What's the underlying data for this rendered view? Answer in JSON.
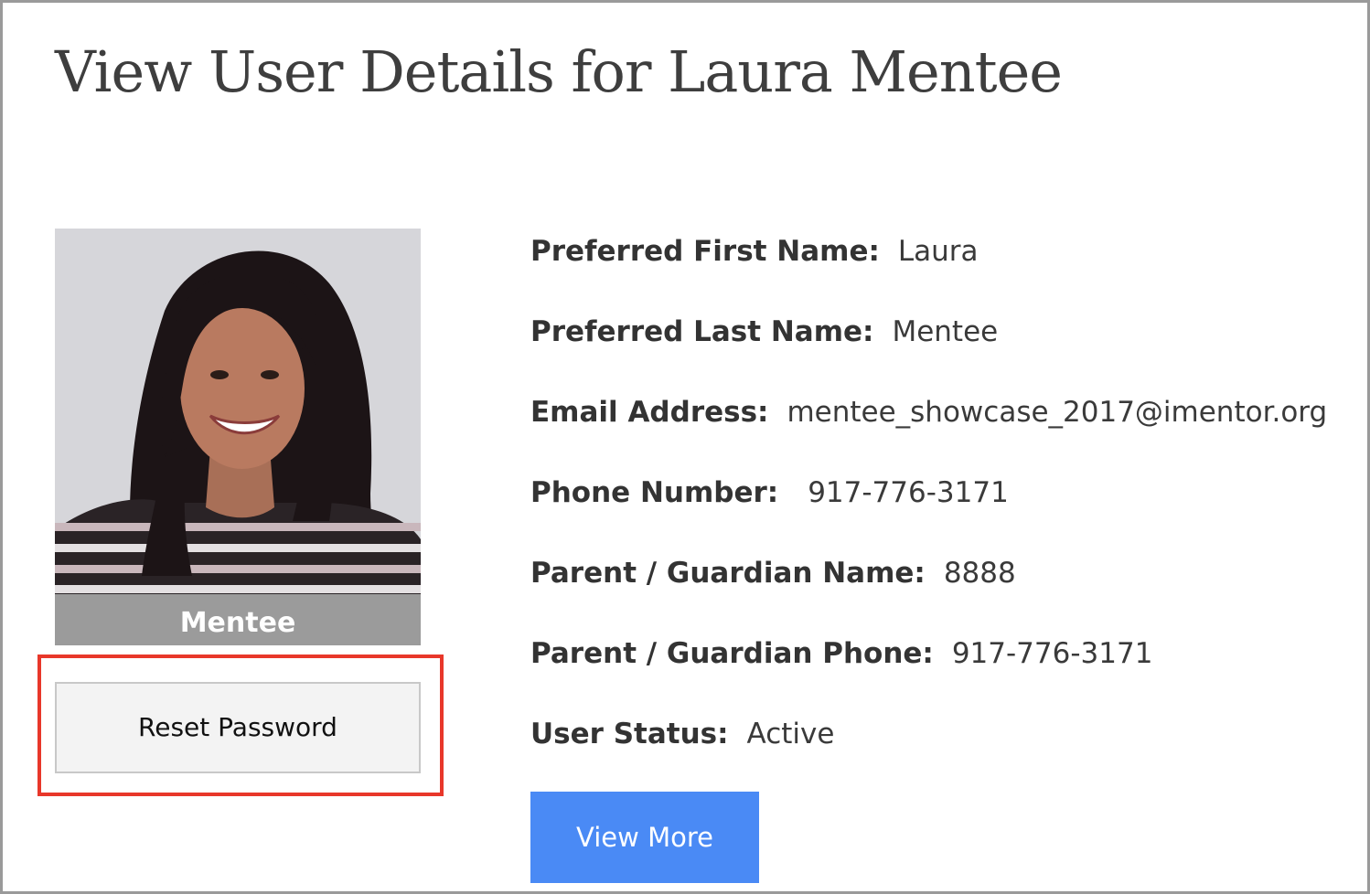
{
  "page": {
    "title": "View User Details for Laura Mentee"
  },
  "profile": {
    "role": "Mentee",
    "reset_password_label": "Reset Password"
  },
  "details": [
    {
      "label": "Preferred First Name:",
      "value": "Laura"
    },
    {
      "label": "Preferred Last Name:",
      "value": "Mentee"
    },
    {
      "label": "Email Address:",
      "value": "mentee_showcase_2017@imentor.org"
    },
    {
      "label": "Phone Number:",
      "value": "917-776-3171"
    },
    {
      "label": "Parent / Guardian Name:",
      "value": "8888"
    },
    {
      "label": "Parent / Guardian Phone:",
      "value": "917-776-3171"
    },
    {
      "label": "User Status:",
      "value": "Active"
    }
  ],
  "actions": {
    "view_more_label": "View More"
  },
  "colors": {
    "accent": "#4a8af5",
    "highlight": "#e8372a",
    "role_bar": "#9b9b9b"
  }
}
